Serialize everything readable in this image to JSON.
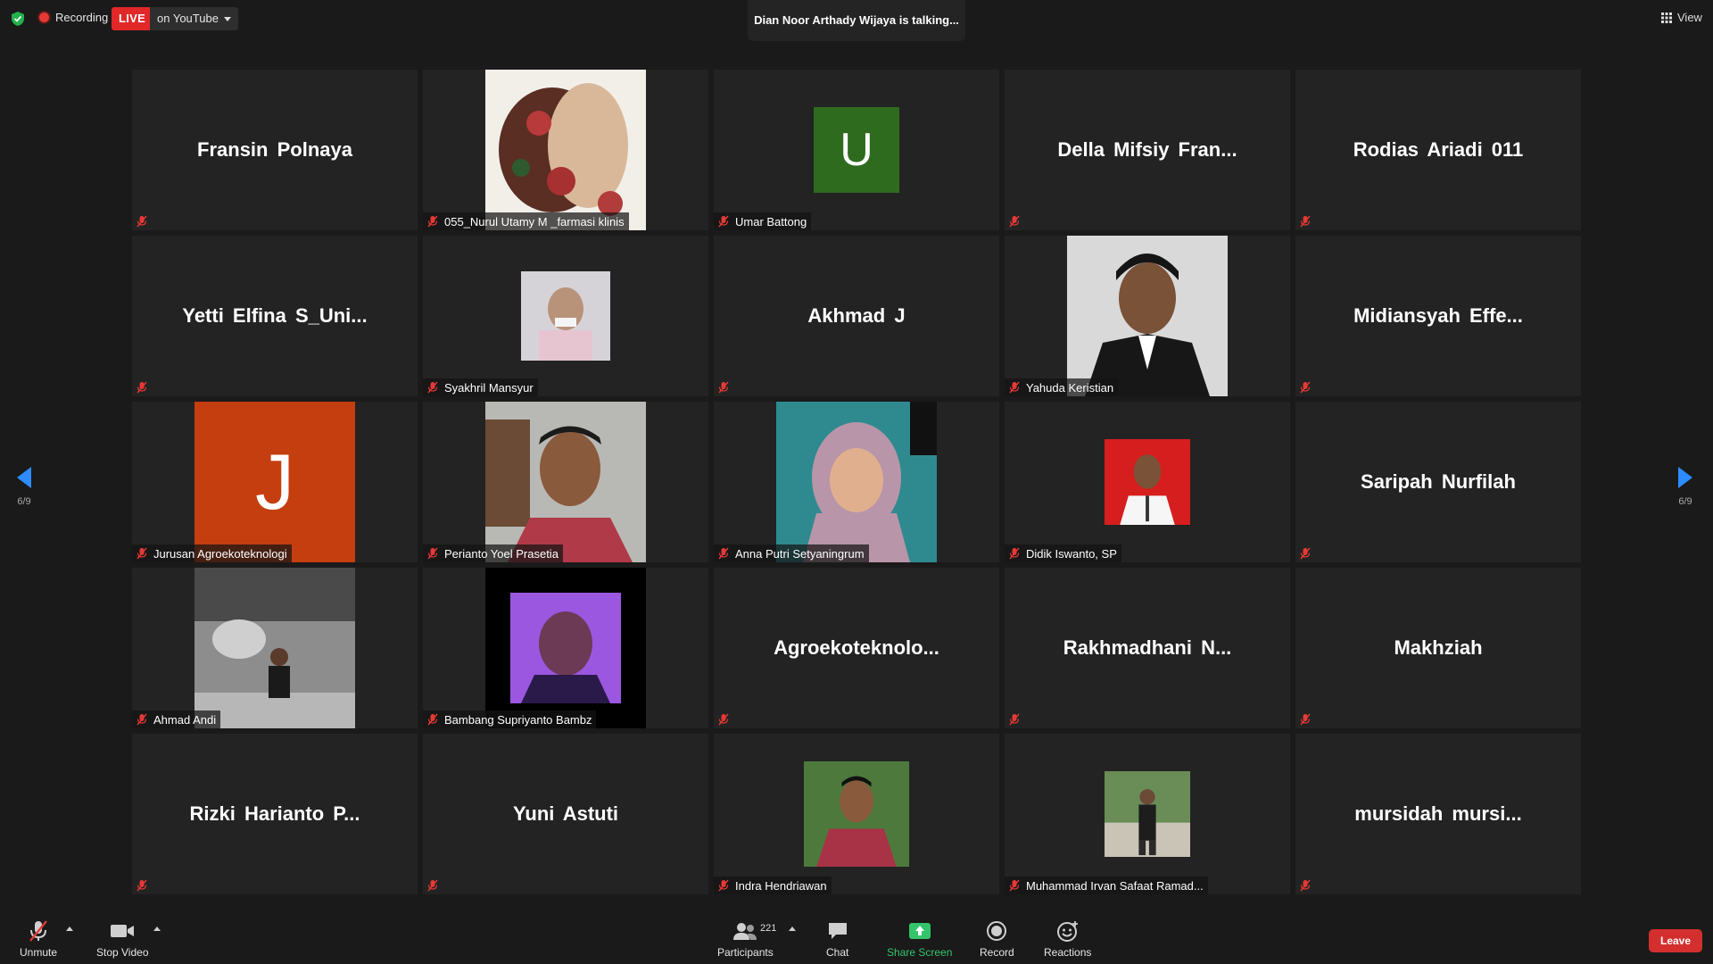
{
  "topbar": {
    "recording_label": "Recording",
    "live_label": "LIVE",
    "platform_label": "on YouTube",
    "talking_text": "Dian Noor Arthady Wijaya is talking...",
    "view_label": "View"
  },
  "pager": {
    "left": "6/9",
    "right": "6/9"
  },
  "tiles": [
    {
      "title": "Fransin Polnaya",
      "footer": ""
    },
    {
      "title": "",
      "footer": "055_Nurul Utamy M _farmasi klinis"
    },
    {
      "title": "",
      "footer": "Umar Battong",
      "avatar": "U",
      "avatar_color": "#2f6b1f"
    },
    {
      "title": "Della  Mifsiy  Fran...",
      "footer": ""
    },
    {
      "title": "Rodias Ariadi 011",
      "footer": ""
    },
    {
      "title": "Yetti  Elfina  S_Uni...",
      "footer": ""
    },
    {
      "title": "",
      "footer": "Syakhril Mansyur"
    },
    {
      "title": "Akhmad J",
      "footer": ""
    },
    {
      "title": "",
      "footer": "Yahuda Keristian"
    },
    {
      "title": "Midiansyah  Effe...",
      "footer": ""
    },
    {
      "title": "",
      "footer": "Jurusan Agroekoteknologi",
      "avatar": "J",
      "avatar_color": "#c43e0f"
    },
    {
      "title": "",
      "footer": "Perianto Yoel Prasetia"
    },
    {
      "title": "",
      "footer": "Anna Putri Setyaningrum"
    },
    {
      "title": "",
      "footer": "Didik Iswanto, SP"
    },
    {
      "title": "Saripah Nurfilah",
      "footer": ""
    },
    {
      "title": "",
      "footer": "Ahmad Andi"
    },
    {
      "title": "",
      "footer": "Bambang Supriyanto Bambz"
    },
    {
      "title": "Agroekoteknolo...",
      "footer": ""
    },
    {
      "title": "Rakhmadhani  N...",
      "footer": ""
    },
    {
      "title": "Makhziah",
      "footer": ""
    },
    {
      "title": "Rizki  Harianto  P...",
      "footer": ""
    },
    {
      "title": "Yuni Astuti",
      "footer": ""
    },
    {
      "title": "",
      "footer": "Indra Hendriawan"
    },
    {
      "title": "",
      "footer": "Muhammad Irvan Safaat Ramad..."
    },
    {
      "title": "mursidah  mursi...",
      "footer": ""
    }
  ],
  "toolbar": {
    "unmute": "Unmute",
    "stop_video": "Stop Video",
    "participants": "Participants",
    "participants_count": "221",
    "chat": "Chat",
    "share_screen": "Share Screen",
    "record": "Record",
    "reactions": "Reactions",
    "leave": "Leave"
  },
  "colors": {
    "accent_live": "#e02828",
    "share_green": "#34c46b",
    "leave_red": "#d32f2f",
    "arrow_blue": "#2d8cff"
  }
}
